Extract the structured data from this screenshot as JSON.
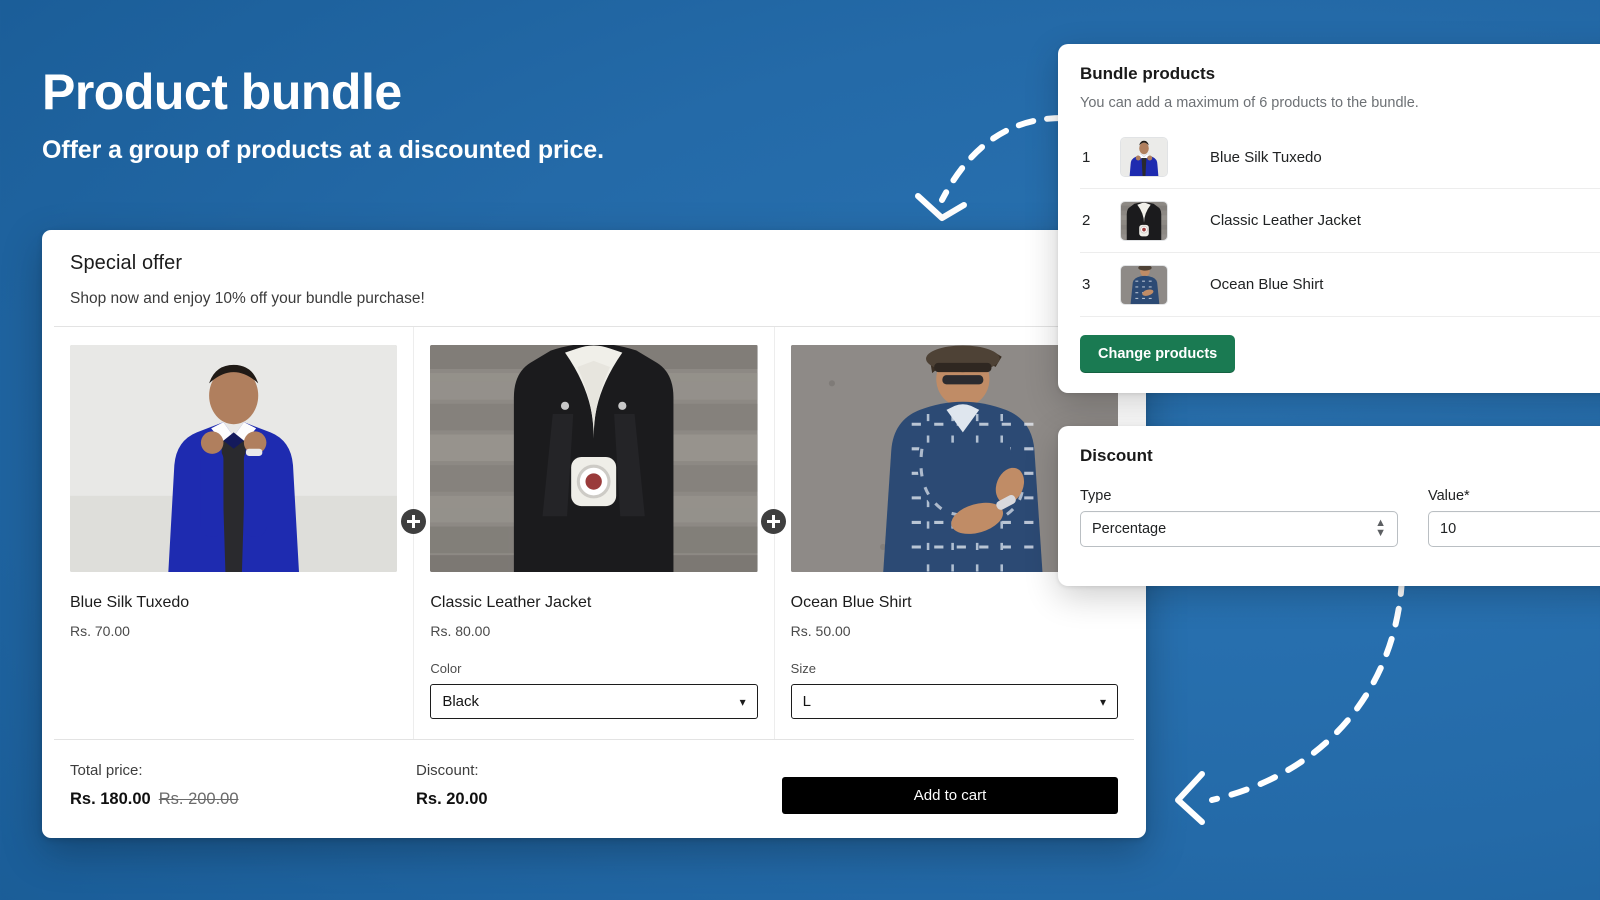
{
  "hero": {
    "title": "Product bundle",
    "subtitle": "Offer a group of products at a discounted price."
  },
  "colors": {
    "background_blue": "#1f6aac",
    "accent_green": "#1a7a52",
    "button_black": "#000000"
  },
  "storefront": {
    "title": "Special offer",
    "subtitle": "Shop now and enjoy 10% off your bundle purchase!",
    "products": [
      {
        "name": "Blue Silk Tuxedo",
        "price": "Rs. 70.00",
        "option_label": "",
        "option_value": ""
      },
      {
        "name": "Classic Leather Jacket",
        "price": "Rs. 80.00",
        "option_label": "Color",
        "option_value": "Black"
      },
      {
        "name": "Ocean Blue Shirt",
        "price": "Rs. 50.00",
        "option_label": "Size",
        "option_value": "L"
      }
    ],
    "plus_icon": "plus-icon",
    "footer": {
      "total_label": "Total price:",
      "total_value": "Rs. 180.00",
      "total_compare_at": "Rs. 200.00",
      "discount_label": "Discount:",
      "discount_value": "Rs. 20.00",
      "add_to_cart_label": "Add to cart"
    }
  },
  "admin": {
    "bundle": {
      "title": "Bundle products",
      "subtitle": "You can add a maximum of 6 products to the bundle.",
      "rows": [
        {
          "index": "1",
          "name": "Blue Silk Tuxedo"
        },
        {
          "index": "2",
          "name": "Classic Leather Jacket"
        },
        {
          "index": "3",
          "name": "Ocean Blue Shirt"
        }
      ],
      "change_products_label": "Change products"
    },
    "discount": {
      "title": "Discount",
      "type_label": "Type",
      "type_value": "Percentage",
      "type_options": [
        "Percentage"
      ],
      "value_label": "Value*",
      "value": "10",
      "stepper_icon": "up-down-chevrons-icon"
    }
  },
  "annotations": {
    "arrow_top": "dashed-curved-arrow-down-left",
    "arrow_bottom": "dashed-curved-arrow-left"
  }
}
